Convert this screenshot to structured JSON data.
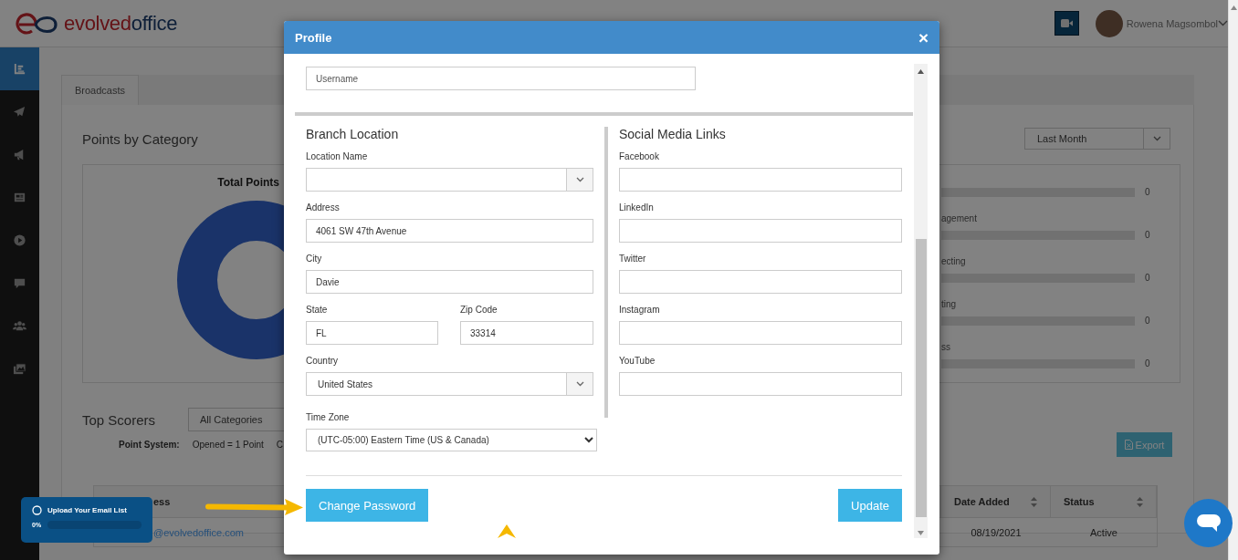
{
  "header": {
    "logo": [
      "evolved",
      "office"
    ],
    "user_name": "Rowena Magsombol"
  },
  "sidebar": {
    "items": [
      {
        "selected": true
      },
      {
        "selected": false
      },
      {
        "selected": false
      },
      {
        "selected": false
      },
      {
        "selected": false
      },
      {
        "selected": false
      },
      {
        "selected": false
      },
      {
        "selected": false
      }
    ]
  },
  "tabs": [
    {
      "label": "Broadcasts",
      "selected": true
    }
  ],
  "points_by_category": {
    "title": "Points by Category",
    "period": "Last Month",
    "chart_title": "Total Points",
    "bars": [
      {
        "value": "0",
        "level": 0
      },
      {
        "label": "agement",
        "value": "0",
        "level": 0
      },
      {
        "label": "ecting",
        "value": "0",
        "level": 0
      },
      {
        "label": "ting",
        "value": "0",
        "level": 0
      },
      {
        "label": "ss",
        "value": "0",
        "level": 0
      }
    ]
  },
  "top_scorers": {
    "title": "Top Scorers",
    "category": "All Categories",
    "point_system_label": "Point System:",
    "point_rules": [
      "Opened = 1 Point",
      "C"
    ],
    "export": "Export",
    "columns": [
      {
        "label": "ess"
      },
      {
        "label": "Date Added",
        "sortable": true
      },
      {
        "label": "Status",
        "sortable": true
      }
    ],
    "rows": [
      {
        "cells": [
          "@evolvedoffice.com",
          "08/19/2021",
          "Active"
        ]
      }
    ]
  },
  "upload_toast": {
    "title": "Upload Your Email List",
    "progress": "0%",
    "level": 0
  },
  "modal": {
    "title": "Profile",
    "close": "×",
    "username": {
      "placeholder": "Username"
    },
    "branch": {
      "heading": "Branch Location",
      "rows": [
        [
          {
            "label": "Location Name",
            "kind": "select"
          }
        ],
        [
          {
            "label": "Address",
            "kind": "text",
            "value": "4061 SW 47th Avenue"
          }
        ],
        [
          {
            "label": "City",
            "kind": "text",
            "value": "Davie"
          }
        ],
        [
          {
            "label": "State",
            "kind": "text",
            "value": "FL"
          },
          {
            "label": "Zip Code",
            "kind": "text",
            "value": "33314"
          }
        ],
        [
          {
            "label": "Country",
            "kind": "select",
            "value": "United States"
          }
        ]
      ],
      "time_zone": {
        "label": "Time Zone",
        "kind": "native-select",
        "value": "(UTC-05:00) Eastern Time (US & Canada)"
      }
    },
    "social": {
      "heading": "Social Media Links",
      "fields": [
        {
          "label": "Facebook",
          "kind": "text"
        },
        {
          "label": "LinkedIn",
          "kind": "text"
        },
        {
          "label": "Twitter",
          "kind": "text"
        },
        {
          "label": "Instagram",
          "kind": "text"
        },
        {
          "label": "YouTube",
          "kind": "text"
        }
      ]
    },
    "change_password": "Change Password",
    "update": "Update"
  }
}
